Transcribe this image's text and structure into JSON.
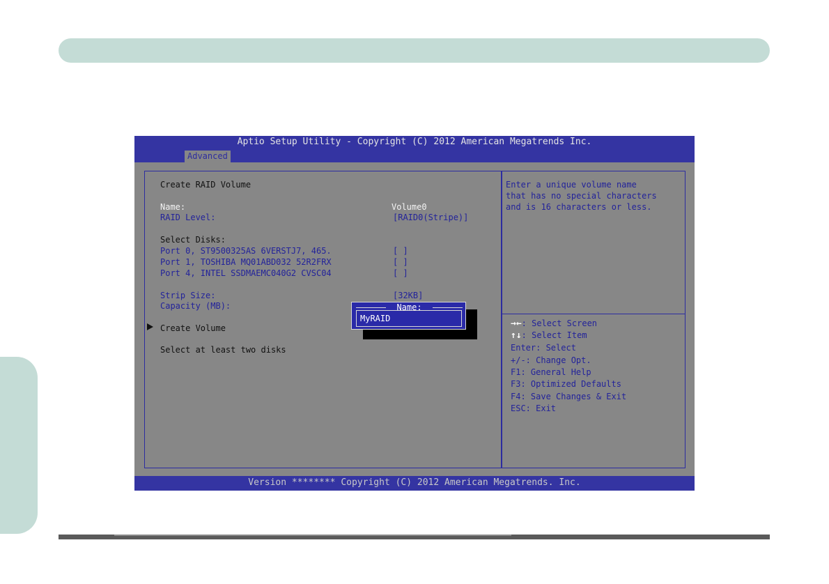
{
  "bios": {
    "title": "Aptio Setup Utility - Copyright (C) 2012 American Megatrends Inc.",
    "tab": "Advanced",
    "version": "Version ******** Copyright (C) 2012 American Megatrends. Inc."
  },
  "main": {
    "heading": "Create RAID Volume",
    "name_label": "Name:",
    "name_value": "Volume0",
    "raid_level_label": "RAID Level:",
    "raid_level_value": "[RAID0(Stripe)]",
    "select_disks_label": "Select Disks:",
    "disks": [
      {
        "label": "Port 0, ST9500325AS 6VERSTJ7, 465.",
        "value": "[ ]"
      },
      {
        "label": "Port 1, TOSHIBA MQ01ABD032 52R2FRX",
        "value": "[ ]"
      },
      {
        "label": "Port 4, INTEL SSDMAEMC040G2 CVSC04",
        "value": "[ ]"
      }
    ],
    "strip_size_label": "Strip Size:",
    "strip_size_value": "[32KB]",
    "capacity_label": "Capacity (MB):",
    "create_volume": "Create Volume",
    "note": "Select at least two disks"
  },
  "help": {
    "lines": [
      "Enter a unique volume name",
      "that has no special characters",
      "and is 16 characters or less."
    ]
  },
  "keys": {
    "screen_icon": "→←",
    "screen": ": Select Screen",
    "item_icon": "↑↓",
    "item": ": Select Item",
    "enter": "Enter: Select",
    "change": "+/-: Change Opt.",
    "f1": "F1: General Help",
    "f3": "F3: Optimized Defaults",
    "f4": "F4: Save Changes & Exit",
    "esc": "ESC: Exit"
  },
  "popup": {
    "title": "Name:",
    "value": "MyRAID"
  },
  "colors": {
    "bios_blue": "#3434a2",
    "bios_gray": "#878787",
    "page_accent": "#c4dcd6"
  }
}
